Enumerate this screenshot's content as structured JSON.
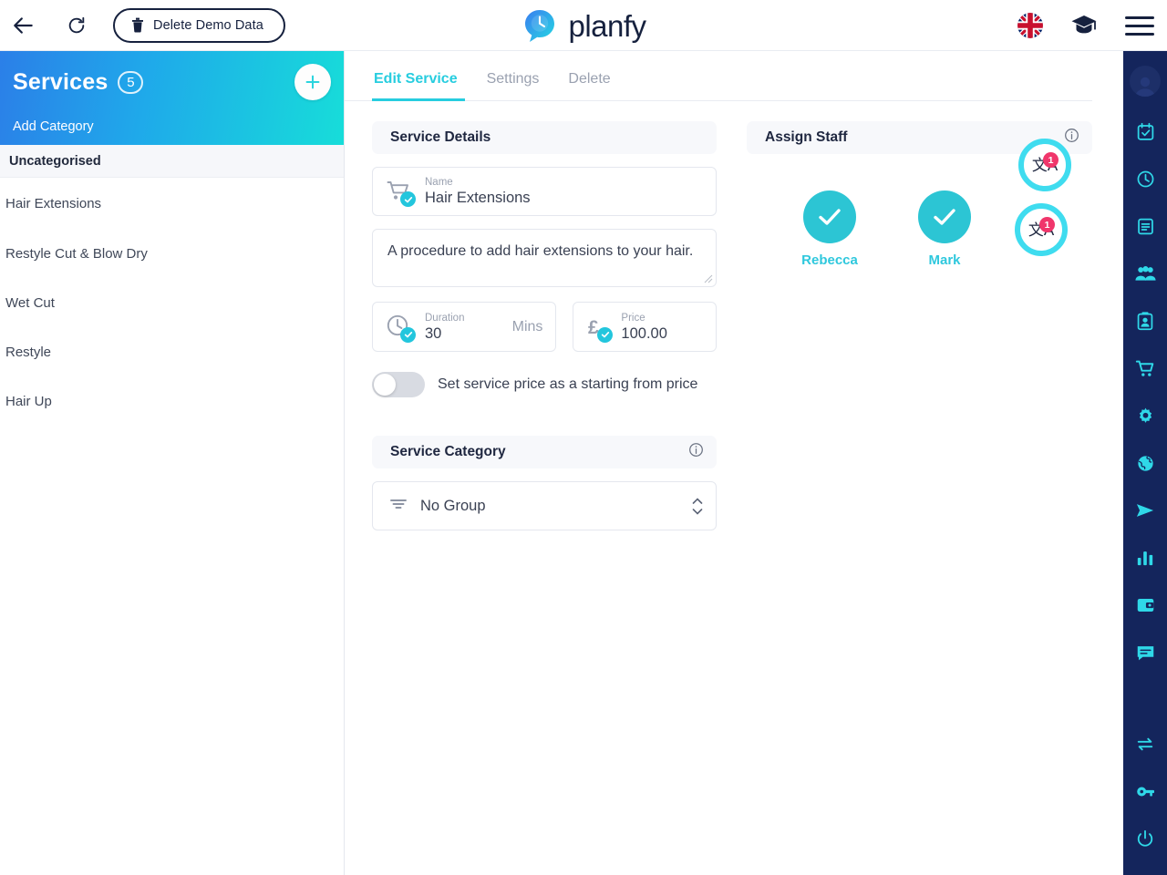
{
  "topbar": {
    "back_icon": "arrow-left-icon",
    "reload_icon": "reload-icon",
    "delete_demo_label": "Delete Demo Data",
    "delete_demo_icon": "trash-icon",
    "brand_name": "planfy",
    "brand_logo_icon": "planfy-clock-bubble-logo",
    "flag_icon": "uk-flag-icon",
    "academy_icon": "graduation-cap-icon",
    "menu_icon": "hamburger-menu-icon"
  },
  "sidebar": {
    "title": "Services",
    "count": "5",
    "add_service_icon": "plus-icon",
    "add_category_label": "Add Category",
    "category_header": "Uncategorised",
    "services": [
      {
        "label": "Hair Extensions"
      },
      {
        "label": "Restyle Cut & Blow Dry"
      },
      {
        "label": "Wet Cut"
      },
      {
        "label": "Restyle"
      },
      {
        "label": "Hair Up"
      }
    ]
  },
  "tabs": [
    {
      "label": "Edit Service",
      "active": true
    },
    {
      "label": "Settings",
      "active": false
    },
    {
      "label": "Delete",
      "active": false
    }
  ],
  "service_details": {
    "panel_title": "Service Details",
    "name_label": "Name",
    "name_value": "Hair Extensions",
    "name_icon": "cart-icon",
    "description_value": "A procedure to add hair extensions to your hair.",
    "duration_label": "Duration",
    "duration_value": "30",
    "duration_unit": "Mins",
    "duration_icon": "clock-icon",
    "price_label": "Price",
    "price_value": "100.00",
    "price_icon": "pound-sterling-icon",
    "starting_price_toggle_label": "Set service price as a starting from price",
    "starting_price_toggle_state": "off"
  },
  "translate_buttons": [
    {
      "name": "translate-name-button",
      "glyph": "文A",
      "badge": "1"
    },
    {
      "name": "translate-description-button",
      "glyph": "文A",
      "badge": "1"
    }
  ],
  "service_category": {
    "panel_title": "Service Category",
    "info_icon": "info-icon",
    "selected": "No Group",
    "select_icon": "filter-icon",
    "chevron_icon": "chevron-up-down-icon"
  },
  "assign_staff": {
    "panel_title": "Assign Staff",
    "info_icon": "info-icon",
    "members": [
      {
        "name": "Rebecca",
        "selected": true
      },
      {
        "name": "Mark",
        "selected": true
      }
    ]
  },
  "rail": {
    "avatar_icon": "user-avatar-icon",
    "items": [
      {
        "icon": "calendar-check-icon"
      },
      {
        "icon": "clock-icon"
      },
      {
        "icon": "list-icon"
      },
      {
        "icon": "people-icon"
      },
      {
        "icon": "contact-card-icon"
      },
      {
        "icon": "cart-icon"
      },
      {
        "icon": "gear-icon"
      },
      {
        "icon": "globe-icon"
      },
      {
        "icon": "send-icon"
      },
      {
        "icon": "bar-chart-icon"
      },
      {
        "icon": "wallet-icon"
      },
      {
        "icon": "chat-icon"
      }
    ],
    "bottom_items": [
      {
        "icon": "swap-icon"
      },
      {
        "icon": "key-icon"
      },
      {
        "icon": "power-icon"
      }
    ]
  },
  "colors": {
    "accent_cyan": "#27cddf",
    "brand_navy": "#16213e",
    "rail_navy": "#14255c",
    "badge_pink": "#f0366b",
    "gradient_start": "#2b7fe8",
    "gradient_end": "#17ddd9"
  }
}
